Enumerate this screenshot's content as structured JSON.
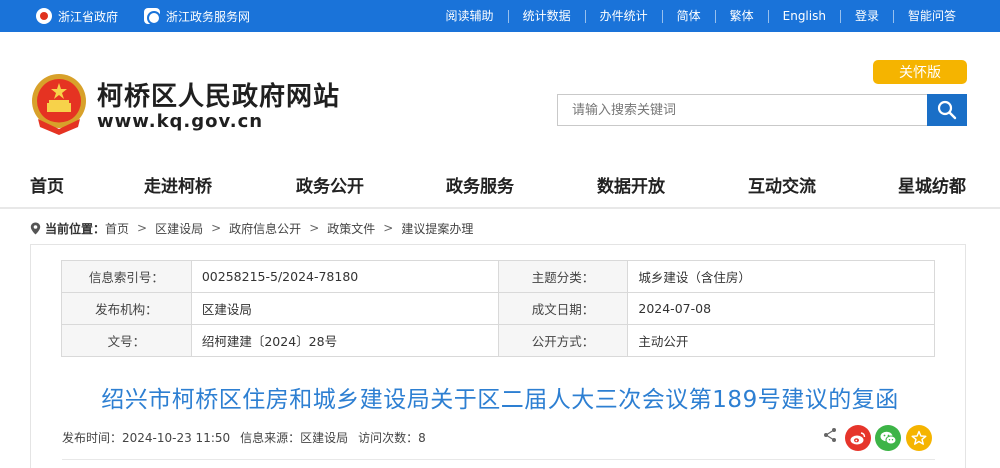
{
  "topbar": {
    "left_links": [
      "浙江省政府",
      "浙江政务服务网"
    ],
    "right_links": [
      "阅读辅助",
      "统计数据",
      "办件统计",
      "简体",
      "繁体",
      "English",
      "登录",
      "智能问答"
    ]
  },
  "header": {
    "site_name": "柯桥区人民政府网站",
    "site_url": "www.kq.gov.cn",
    "care_mode": "关怀版",
    "search_placeholder": "请输入搜索关键词"
  },
  "nav": [
    "首页",
    "走进柯桥",
    "政务公开",
    "政务服务",
    "数据开放",
    "互动交流",
    "星城纺都"
  ],
  "breadcrumb": {
    "label": "当前位置：",
    "items": [
      "首页",
      "区建设局",
      "政府信息公开",
      "政策文件",
      "建议提案办理"
    ],
    "separator": ">"
  },
  "meta": {
    "rows": [
      {
        "k1": "信息索引号：",
        "v1": "00258215-5/2024-78180",
        "k2": "主题分类：",
        "v2": "城乡建设（含住房）"
      },
      {
        "k1": "发布机构：",
        "v1": "区建设局",
        "k2": "成文日期：",
        "v2": "2024-07-08"
      },
      {
        "k1": "文号：",
        "v1": "绍柯建建〔2024〕28号",
        "k2": "公开方式：",
        "v2": "主动公开"
      }
    ]
  },
  "article": {
    "title": "绍兴市柯桥区住房和城乡建设局关于区二届人大三次会议第189号建议的复函",
    "publish_time": "发布时间：2024-10-23 11:50",
    "source": "信息来源：区建设局",
    "visits": "访问次数：8"
  },
  "colors": {
    "topbar": "#1a73d9",
    "accent_title": "#2d7fd2",
    "care_button": "#f5b400",
    "search_button": "#1a6fc7"
  }
}
